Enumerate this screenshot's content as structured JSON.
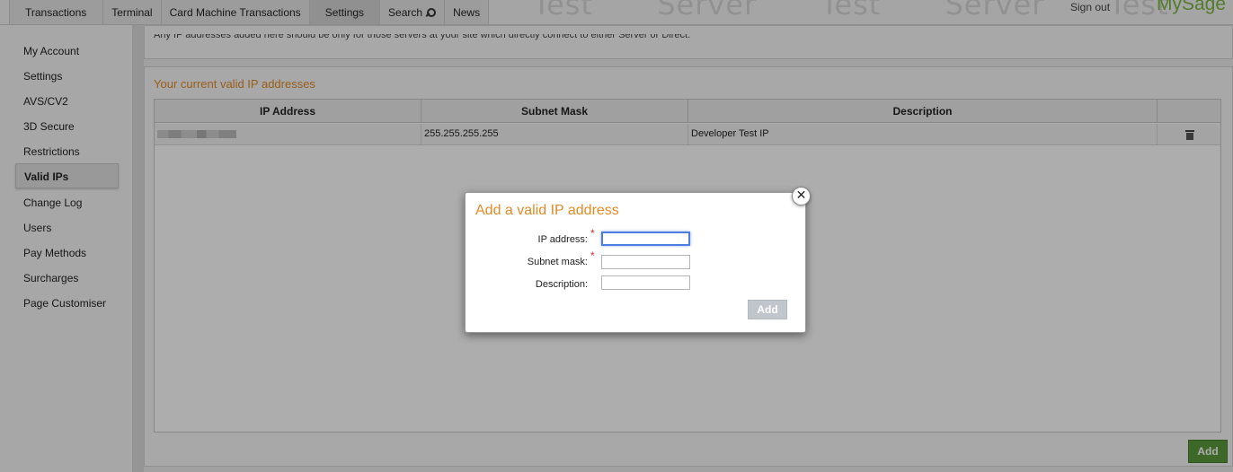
{
  "topbar": {
    "tabs": [
      {
        "label": "Transactions"
      },
      {
        "label": "Terminal"
      },
      {
        "label": "Card Machine Transactions"
      },
      {
        "label": "Settings"
      },
      {
        "label": "Search"
      },
      {
        "label": "News"
      }
    ],
    "active_tab": "Settings",
    "watermark": "Test Server Test Server Test Serv",
    "sign_out": "Sign out",
    "brand": "MySage"
  },
  "sidebar": {
    "items": [
      {
        "label": "My Account"
      },
      {
        "label": "Settings"
      },
      {
        "label": "AVS/CV2"
      },
      {
        "label": "3D Secure"
      },
      {
        "label": "Restrictions"
      },
      {
        "label": "Valid IPs"
      },
      {
        "label": "Change Log"
      },
      {
        "label": "Users"
      },
      {
        "label": "Pay Methods"
      },
      {
        "label": "Surcharges"
      },
      {
        "label": "Page Customiser"
      }
    ],
    "active_item": "Valid IPs"
  },
  "notice": {
    "text": "Any IP addresses added here should be only for those servers at your site which directly connect to either Server or Direct."
  },
  "panel": {
    "title": "Your current valid IP addresses",
    "columns": [
      "IP Address",
      "Subnet Mask",
      "Description"
    ],
    "rows": [
      {
        "ip": "",
        "subnet_mask": "255.255.255.255",
        "description": "Developer Test IP"
      }
    ],
    "add_button": "Add"
  },
  "dialog": {
    "title": "Add a valid IP address",
    "close_glyph": "✕",
    "required_glyph": "*",
    "fields": [
      {
        "label": "IP address:",
        "required": true,
        "value": ""
      },
      {
        "label": "Subnet mask:",
        "required": true,
        "value": ""
      },
      {
        "label": "Description:",
        "required": false,
        "value": ""
      }
    ],
    "add_button": "Add"
  },
  "colors": {
    "accent_orange": "#e18b28",
    "brand_green": "#7bb542",
    "add_button_green": "#5b9a3a",
    "required_red": "#d9342b",
    "focus_blue": "#4d7de0"
  }
}
